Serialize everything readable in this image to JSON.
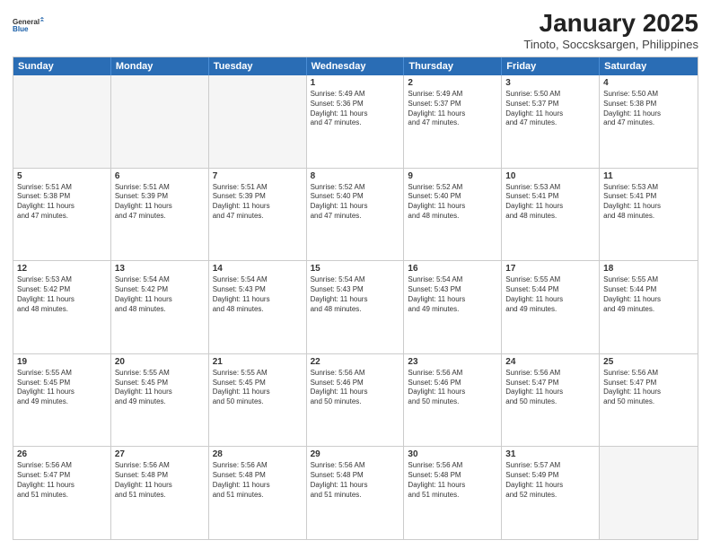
{
  "logo": {
    "general": "General",
    "blue": "Blue"
  },
  "header": {
    "title": "January 2025",
    "subtitle": "Tinoto, Soccsksargen, Philippines"
  },
  "days": [
    "Sunday",
    "Monday",
    "Tuesday",
    "Wednesday",
    "Thursday",
    "Friday",
    "Saturday"
  ],
  "rows": [
    [
      {
        "day": "",
        "empty": true,
        "lines": []
      },
      {
        "day": "",
        "empty": true,
        "lines": []
      },
      {
        "day": "",
        "empty": true,
        "lines": []
      },
      {
        "day": "1",
        "empty": false,
        "lines": [
          "Sunrise: 5:49 AM",
          "Sunset: 5:36 PM",
          "Daylight: 11 hours",
          "and 47 minutes."
        ]
      },
      {
        "day": "2",
        "empty": false,
        "lines": [
          "Sunrise: 5:49 AM",
          "Sunset: 5:37 PM",
          "Daylight: 11 hours",
          "and 47 minutes."
        ]
      },
      {
        "day": "3",
        "empty": false,
        "lines": [
          "Sunrise: 5:50 AM",
          "Sunset: 5:37 PM",
          "Daylight: 11 hours",
          "and 47 minutes."
        ]
      },
      {
        "day": "4",
        "empty": false,
        "lines": [
          "Sunrise: 5:50 AM",
          "Sunset: 5:38 PM",
          "Daylight: 11 hours",
          "and 47 minutes."
        ]
      }
    ],
    [
      {
        "day": "5",
        "empty": false,
        "lines": [
          "Sunrise: 5:51 AM",
          "Sunset: 5:38 PM",
          "Daylight: 11 hours",
          "and 47 minutes."
        ]
      },
      {
        "day": "6",
        "empty": false,
        "lines": [
          "Sunrise: 5:51 AM",
          "Sunset: 5:39 PM",
          "Daylight: 11 hours",
          "and 47 minutes."
        ]
      },
      {
        "day": "7",
        "empty": false,
        "lines": [
          "Sunrise: 5:51 AM",
          "Sunset: 5:39 PM",
          "Daylight: 11 hours",
          "and 47 minutes."
        ]
      },
      {
        "day": "8",
        "empty": false,
        "lines": [
          "Sunrise: 5:52 AM",
          "Sunset: 5:40 PM",
          "Daylight: 11 hours",
          "and 47 minutes."
        ]
      },
      {
        "day": "9",
        "empty": false,
        "lines": [
          "Sunrise: 5:52 AM",
          "Sunset: 5:40 PM",
          "Daylight: 11 hours",
          "and 48 minutes."
        ]
      },
      {
        "day": "10",
        "empty": false,
        "lines": [
          "Sunrise: 5:53 AM",
          "Sunset: 5:41 PM",
          "Daylight: 11 hours",
          "and 48 minutes."
        ]
      },
      {
        "day": "11",
        "empty": false,
        "lines": [
          "Sunrise: 5:53 AM",
          "Sunset: 5:41 PM",
          "Daylight: 11 hours",
          "and 48 minutes."
        ]
      }
    ],
    [
      {
        "day": "12",
        "empty": false,
        "lines": [
          "Sunrise: 5:53 AM",
          "Sunset: 5:42 PM",
          "Daylight: 11 hours",
          "and 48 minutes."
        ]
      },
      {
        "day": "13",
        "empty": false,
        "lines": [
          "Sunrise: 5:54 AM",
          "Sunset: 5:42 PM",
          "Daylight: 11 hours",
          "and 48 minutes."
        ]
      },
      {
        "day": "14",
        "empty": false,
        "lines": [
          "Sunrise: 5:54 AM",
          "Sunset: 5:43 PM",
          "Daylight: 11 hours",
          "and 48 minutes."
        ]
      },
      {
        "day": "15",
        "empty": false,
        "lines": [
          "Sunrise: 5:54 AM",
          "Sunset: 5:43 PM",
          "Daylight: 11 hours",
          "and 48 minutes."
        ]
      },
      {
        "day": "16",
        "empty": false,
        "lines": [
          "Sunrise: 5:54 AM",
          "Sunset: 5:43 PM",
          "Daylight: 11 hours",
          "and 49 minutes."
        ]
      },
      {
        "day": "17",
        "empty": false,
        "lines": [
          "Sunrise: 5:55 AM",
          "Sunset: 5:44 PM",
          "Daylight: 11 hours",
          "and 49 minutes."
        ]
      },
      {
        "day": "18",
        "empty": false,
        "lines": [
          "Sunrise: 5:55 AM",
          "Sunset: 5:44 PM",
          "Daylight: 11 hours",
          "and 49 minutes."
        ]
      }
    ],
    [
      {
        "day": "19",
        "empty": false,
        "lines": [
          "Sunrise: 5:55 AM",
          "Sunset: 5:45 PM",
          "Daylight: 11 hours",
          "and 49 minutes."
        ]
      },
      {
        "day": "20",
        "empty": false,
        "lines": [
          "Sunrise: 5:55 AM",
          "Sunset: 5:45 PM",
          "Daylight: 11 hours",
          "and 49 minutes."
        ]
      },
      {
        "day": "21",
        "empty": false,
        "lines": [
          "Sunrise: 5:55 AM",
          "Sunset: 5:45 PM",
          "Daylight: 11 hours",
          "and 50 minutes."
        ]
      },
      {
        "day": "22",
        "empty": false,
        "lines": [
          "Sunrise: 5:56 AM",
          "Sunset: 5:46 PM",
          "Daylight: 11 hours",
          "and 50 minutes."
        ]
      },
      {
        "day": "23",
        "empty": false,
        "lines": [
          "Sunrise: 5:56 AM",
          "Sunset: 5:46 PM",
          "Daylight: 11 hours",
          "and 50 minutes."
        ]
      },
      {
        "day": "24",
        "empty": false,
        "lines": [
          "Sunrise: 5:56 AM",
          "Sunset: 5:47 PM",
          "Daylight: 11 hours",
          "and 50 minutes."
        ]
      },
      {
        "day": "25",
        "empty": false,
        "lines": [
          "Sunrise: 5:56 AM",
          "Sunset: 5:47 PM",
          "Daylight: 11 hours",
          "and 50 minutes."
        ]
      }
    ],
    [
      {
        "day": "26",
        "empty": false,
        "lines": [
          "Sunrise: 5:56 AM",
          "Sunset: 5:47 PM",
          "Daylight: 11 hours",
          "and 51 minutes."
        ]
      },
      {
        "day": "27",
        "empty": false,
        "lines": [
          "Sunrise: 5:56 AM",
          "Sunset: 5:48 PM",
          "Daylight: 11 hours",
          "and 51 minutes."
        ]
      },
      {
        "day": "28",
        "empty": false,
        "lines": [
          "Sunrise: 5:56 AM",
          "Sunset: 5:48 PM",
          "Daylight: 11 hours",
          "and 51 minutes."
        ]
      },
      {
        "day": "29",
        "empty": false,
        "lines": [
          "Sunrise: 5:56 AM",
          "Sunset: 5:48 PM",
          "Daylight: 11 hours",
          "and 51 minutes."
        ]
      },
      {
        "day": "30",
        "empty": false,
        "lines": [
          "Sunrise: 5:56 AM",
          "Sunset: 5:48 PM",
          "Daylight: 11 hours",
          "and 51 minutes."
        ]
      },
      {
        "day": "31",
        "empty": false,
        "lines": [
          "Sunrise: 5:57 AM",
          "Sunset: 5:49 PM",
          "Daylight: 11 hours",
          "and 52 minutes."
        ]
      },
      {
        "day": "",
        "empty": true,
        "lines": []
      }
    ]
  ]
}
